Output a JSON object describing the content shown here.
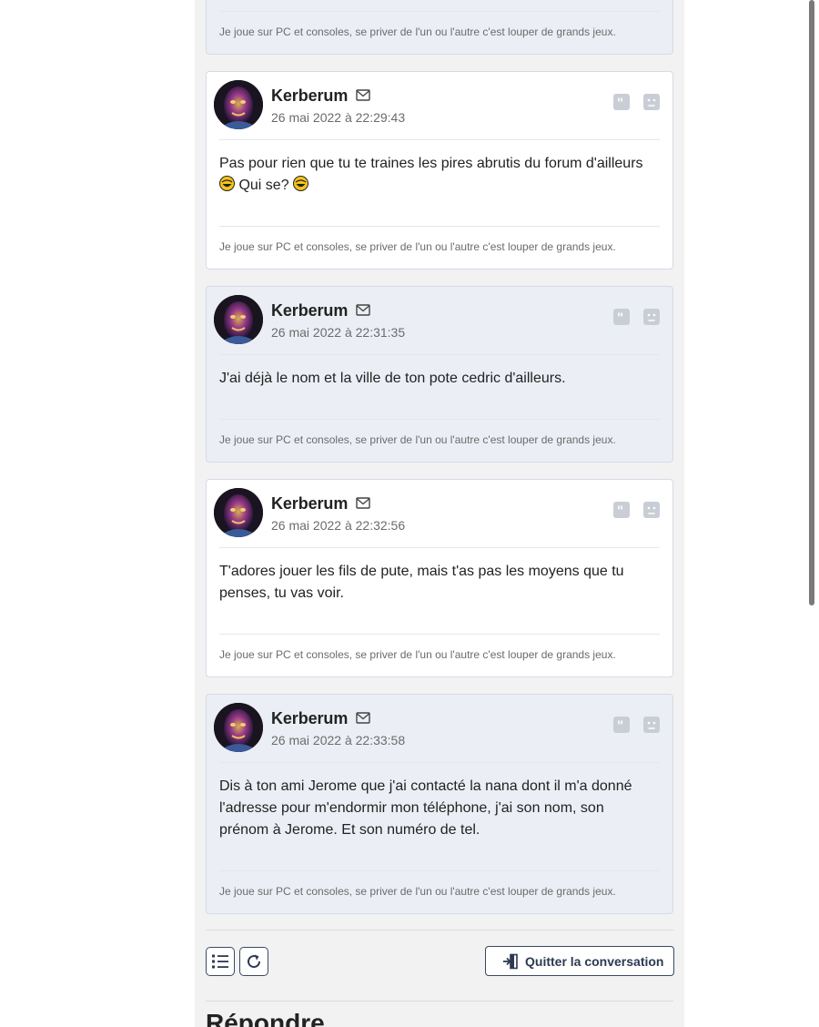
{
  "signature_text": "Je joue sur PC et consoles, se priver de l'un ou l'autre c'est louper de grands jeux.",
  "posts": [
    {
      "author": "Kerberum",
      "date": "26 mai 2022 à 22:29:43",
      "body_line1": "Pas pour rien que tu te traines les pires abrutis du forum d'ailleurs",
      "body_line2": "Qui se?"
    },
    {
      "author": "Kerberum",
      "date": "26 mai 2022 à 22:31:35",
      "body": "J'ai déjà le nom et la ville de ton pote cedric d'ailleurs."
    },
    {
      "author": "Kerberum",
      "date": "26 mai 2022 à 22:32:56",
      "body": "T'adores jouer les fils de pute, mais t'as pas les moyens que tu penses, tu vas voir."
    },
    {
      "author": "Kerberum",
      "date": "26 mai 2022 à 22:33:58",
      "body": "Dis à ton ami Jerome que j'ai contacté la nana dont il m'a donné l'adresse pour m'endormir mon téléphone, j'ai son nom, son prénom à Jerome. Et son numéro de tel."
    }
  ],
  "controls": {
    "quit_label": "Quitter la conversation"
  },
  "reply_heading": "Répondre",
  "icons": {
    "mail": "envelope-icon",
    "quote": "quote-icon",
    "report": "sad-face-icon",
    "list": "list-icon",
    "refresh": "refresh-icon",
    "quit": "exit-door-icon",
    "emoji": "laughing-emoji-icon"
  }
}
